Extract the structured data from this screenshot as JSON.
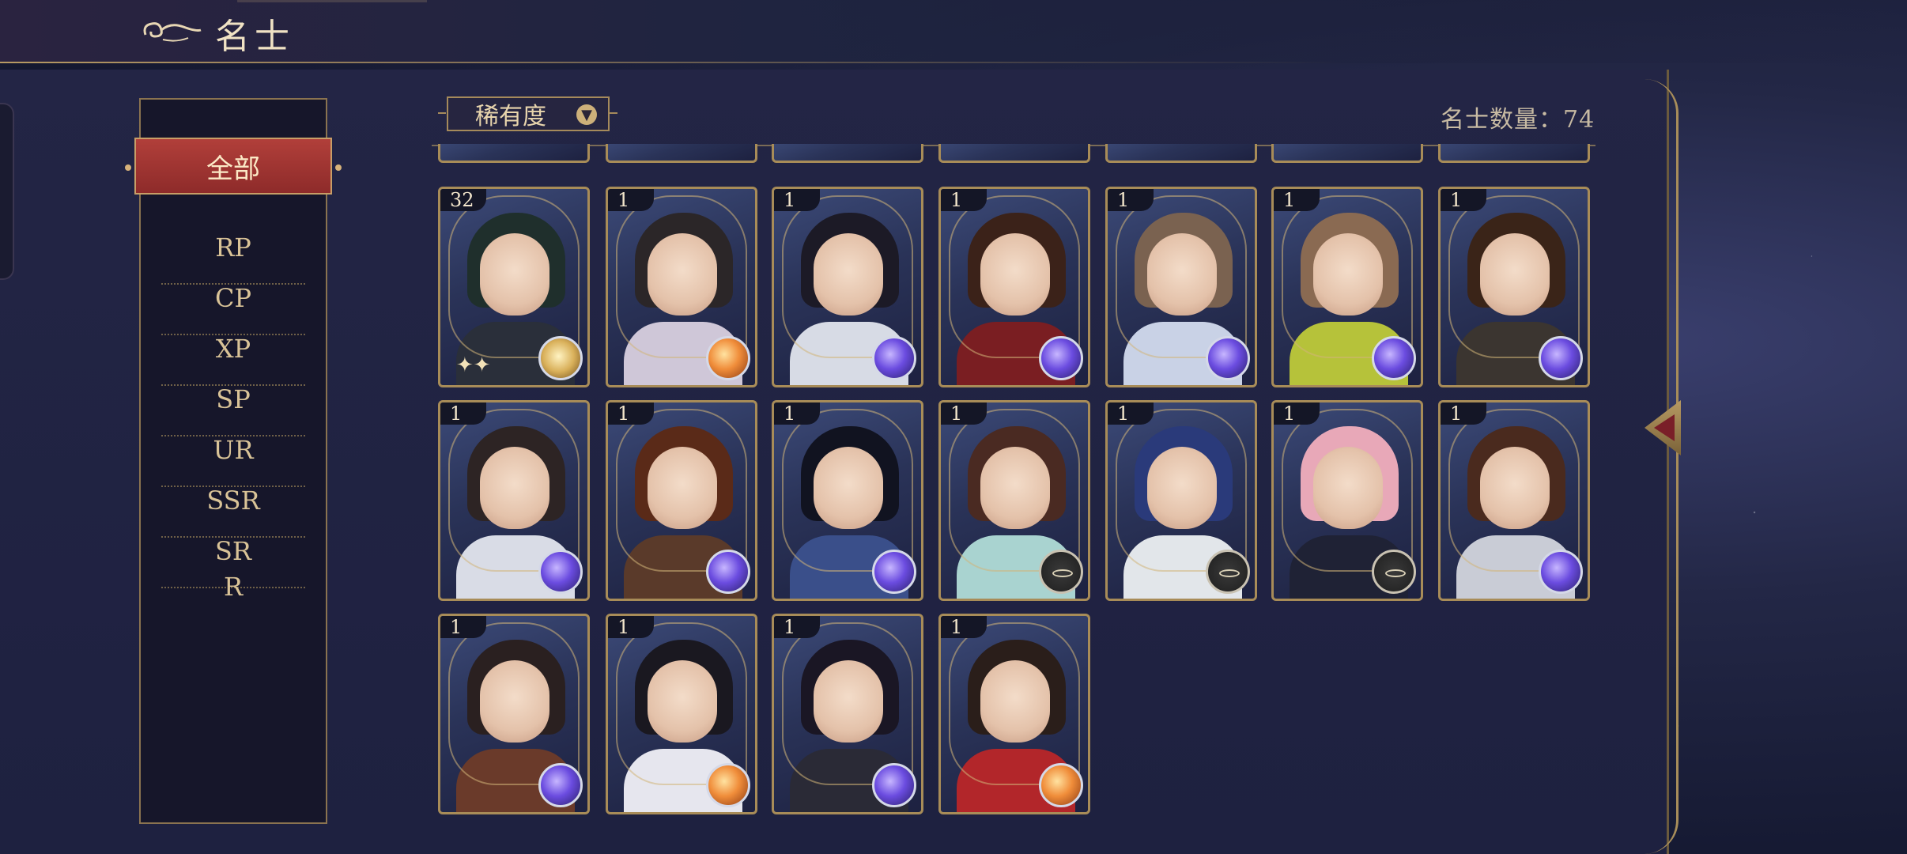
{
  "header": {
    "title": "名士"
  },
  "sidebar": {
    "items": [
      {
        "label": "全部",
        "active": true
      },
      {
        "label": "RP"
      },
      {
        "label": "CP"
      },
      {
        "label": "XP"
      },
      {
        "label": "SP"
      },
      {
        "label": "UR"
      },
      {
        "label": "SSR"
      },
      {
        "label": "SR"
      },
      {
        "label": "R"
      }
    ]
  },
  "filter": {
    "label": "稀有度"
  },
  "count": {
    "text": "名士数量：74"
  },
  "colors": {
    "accent_gold": "#a88c58",
    "active_red": "#9e3432",
    "panel": "#1e2140"
  },
  "cards": [
    {
      "level": "32",
      "orb": "gold",
      "hair": "#1f2f2c",
      "body": "#2a2f3a"
    },
    {
      "level": "1",
      "orb": "orange",
      "hair": "#2b2628",
      "body": "#cfc7d8"
    },
    {
      "level": "1",
      "orb": "purple",
      "hair": "#1c1a26",
      "body": "#d7dbe5"
    },
    {
      "level": "1",
      "orb": "purple",
      "hair": "#3b2219",
      "body": "#7a1e22"
    },
    {
      "level": "1",
      "orb": "purple",
      "hair": "#7a6250",
      "body": "#c9d2e6"
    },
    {
      "level": "1",
      "orb": "purple",
      "hair": "#8a6a52",
      "body": "#b6c23a"
    },
    {
      "level": "1",
      "orb": "purple",
      "hair": "#3a2418",
      "body": "#3b3530"
    },
    {
      "level": "1",
      "orb": "purple",
      "hair": "#2d2424",
      "body": "#d9dce6"
    },
    {
      "level": "1",
      "orb": "purple",
      "hair": "#5a2a18",
      "body": "#5a3a2a"
    },
    {
      "level": "1",
      "orb": "purple",
      "hair": "#111320",
      "body": "#3a4f8a"
    },
    {
      "level": "1",
      "orb": "compass",
      "hair": "#4a2a22",
      "body": "#a9d3d0"
    },
    {
      "level": "1",
      "orb": "compass",
      "hair": "#2a3a7a",
      "body": "#e2e6ea"
    },
    {
      "level": "1",
      "orb": "compass",
      "hair": "#e8a8b8",
      "body": "#1f2235"
    },
    {
      "level": "1",
      "orb": "purple",
      "hair": "#4a2a1e",
      "body": "#c9ccd6"
    },
    {
      "level": "1",
      "orb": "purple",
      "hair": "#2a2020",
      "body": "#6a3a2a"
    },
    {
      "level": "1",
      "orb": "orange",
      "hair": "#1a1820",
      "body": "#e6e6ee"
    },
    {
      "level": "1",
      "orb": "purple",
      "hair": "#1a1624",
      "body": "#2a2a36"
    },
    {
      "level": "1",
      "orb": "orange",
      "hair": "#2a1e1a",
      "body": "#b2262a"
    }
  ]
}
